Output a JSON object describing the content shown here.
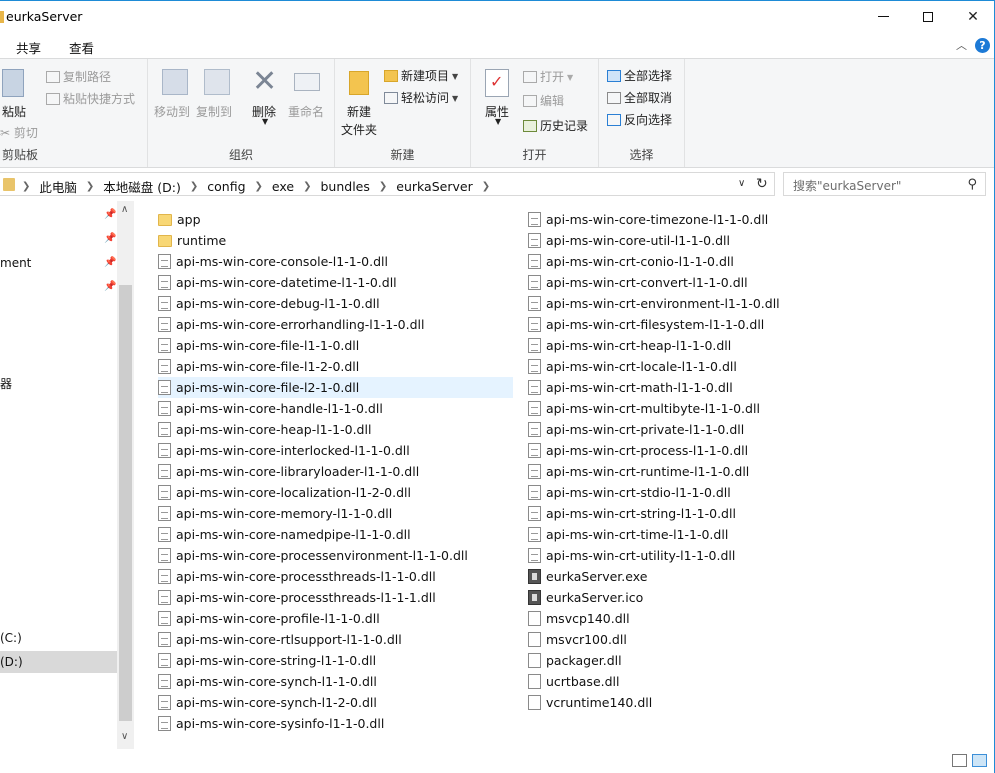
{
  "window": {
    "title": "eurkaServer"
  },
  "menu": {
    "tabs": [
      "共享",
      "查看"
    ]
  },
  "ribbon": {
    "clipboard": {
      "paste": "粘贴",
      "copy_path": "复制路径",
      "paste_shortcut": "粘贴快捷方式",
      "cut": "剪切",
      "label": "剪贴板"
    },
    "organize": {
      "move_to": "移动到",
      "copy_to": "复制到",
      "delete": "删除",
      "rename": "重命名",
      "label": "组织"
    },
    "new": {
      "new_folder_line1": "新建",
      "new_folder_line2": "文件夹",
      "new_item": "新建项目",
      "easy_access": "轻松访问",
      "label": "新建"
    },
    "open": {
      "properties": "属性",
      "open": "打开",
      "edit": "编辑",
      "history": "历史记录",
      "label": "打开"
    },
    "select": {
      "select_all": "全部选择",
      "select_none": "全部取消",
      "invert": "反向选择",
      "label": "选择"
    }
  },
  "address": {
    "crumbs": [
      "此电脑",
      "本地磁盘 (D:)",
      "config",
      "exe",
      "bundles",
      "eurkaServer"
    ],
    "search_placeholder": "搜索\"eurkaServer\""
  },
  "nav": {
    "items": [
      "ment",
      "器",
      "(C:)",
      "(D:)"
    ]
  },
  "files": {
    "col1": [
      {
        "name": "app",
        "type": "folder"
      },
      {
        "name": "runtime",
        "type": "folder"
      },
      {
        "name": "api-ms-win-core-console-l1-1-0.dll",
        "type": "dll"
      },
      {
        "name": "api-ms-win-core-datetime-l1-1-0.dll",
        "type": "dll"
      },
      {
        "name": "api-ms-win-core-debug-l1-1-0.dll",
        "type": "dll"
      },
      {
        "name": "api-ms-win-core-errorhandling-l1-1-0.dll",
        "type": "dll"
      },
      {
        "name": "api-ms-win-core-file-l1-1-0.dll",
        "type": "dll"
      },
      {
        "name": "api-ms-win-core-file-l1-2-0.dll",
        "type": "dll"
      },
      {
        "name": "api-ms-win-core-file-l2-1-0.dll",
        "type": "dll"
      },
      {
        "name": "api-ms-win-core-handle-l1-1-0.dll",
        "type": "dll"
      },
      {
        "name": "api-ms-win-core-heap-l1-1-0.dll",
        "type": "dll"
      },
      {
        "name": "api-ms-win-core-interlocked-l1-1-0.dll",
        "type": "dll"
      },
      {
        "name": "api-ms-win-core-libraryloader-l1-1-0.dll",
        "type": "dll"
      },
      {
        "name": "api-ms-win-core-localization-l1-2-0.dll",
        "type": "dll"
      },
      {
        "name": "api-ms-win-core-memory-l1-1-0.dll",
        "type": "dll"
      },
      {
        "name": "api-ms-win-core-namedpipe-l1-1-0.dll",
        "type": "dll"
      },
      {
        "name": "api-ms-win-core-processenvironment-l1-1-0.dll",
        "type": "dll"
      },
      {
        "name": "api-ms-win-core-processthreads-l1-1-0.dll",
        "type": "dll"
      },
      {
        "name": "api-ms-win-core-processthreads-l1-1-1.dll",
        "type": "dll"
      },
      {
        "name": "api-ms-win-core-profile-l1-1-0.dll",
        "type": "dll"
      },
      {
        "name": "api-ms-win-core-rtlsupport-l1-1-0.dll",
        "type": "dll"
      },
      {
        "name": "api-ms-win-core-string-l1-1-0.dll",
        "type": "dll"
      },
      {
        "name": "api-ms-win-core-synch-l1-1-0.dll",
        "type": "dll"
      },
      {
        "name": "api-ms-win-core-synch-l1-2-0.dll",
        "type": "dll"
      },
      {
        "name": "api-ms-win-core-sysinfo-l1-1-0.dll",
        "type": "dll"
      }
    ],
    "col2": [
      {
        "name": "api-ms-win-core-timezone-l1-1-0.dll",
        "type": "dll"
      },
      {
        "name": "api-ms-win-core-util-l1-1-0.dll",
        "type": "dll"
      },
      {
        "name": "api-ms-win-crt-conio-l1-1-0.dll",
        "type": "dll"
      },
      {
        "name": "api-ms-win-crt-convert-l1-1-0.dll",
        "type": "dll"
      },
      {
        "name": "api-ms-win-crt-environment-l1-1-0.dll",
        "type": "dll"
      },
      {
        "name": "api-ms-win-crt-filesystem-l1-1-0.dll",
        "type": "dll"
      },
      {
        "name": "api-ms-win-crt-heap-l1-1-0.dll",
        "type": "dll"
      },
      {
        "name": "api-ms-win-crt-locale-l1-1-0.dll",
        "type": "dll"
      },
      {
        "name": "api-ms-win-crt-math-l1-1-0.dll",
        "type": "dll"
      },
      {
        "name": "api-ms-win-crt-multibyte-l1-1-0.dll",
        "type": "dll"
      },
      {
        "name": "api-ms-win-crt-private-l1-1-0.dll",
        "type": "dll"
      },
      {
        "name": "api-ms-win-crt-process-l1-1-0.dll",
        "type": "dll"
      },
      {
        "name": "api-ms-win-crt-runtime-l1-1-0.dll",
        "type": "dll"
      },
      {
        "name": "api-ms-win-crt-stdio-l1-1-0.dll",
        "type": "dll"
      },
      {
        "name": "api-ms-win-crt-string-l1-1-0.dll",
        "type": "dll"
      },
      {
        "name": "api-ms-win-crt-time-l1-1-0.dll",
        "type": "dll"
      },
      {
        "name": "api-ms-win-crt-utility-l1-1-0.dll",
        "type": "dll"
      },
      {
        "name": "eurkaServer.exe",
        "type": "exe"
      },
      {
        "name": "eurkaServer.ico",
        "type": "exe"
      },
      {
        "name": "msvcp140.dll",
        "type": "plain"
      },
      {
        "name": "msvcr100.dll",
        "type": "plain"
      },
      {
        "name": "packager.dll",
        "type": "plain"
      },
      {
        "name": "ucrtbase.dll",
        "type": "plain"
      },
      {
        "name": "vcruntime140.dll",
        "type": "plain"
      }
    ],
    "selected": "api-ms-win-core-file-l2-1-0.dll"
  }
}
